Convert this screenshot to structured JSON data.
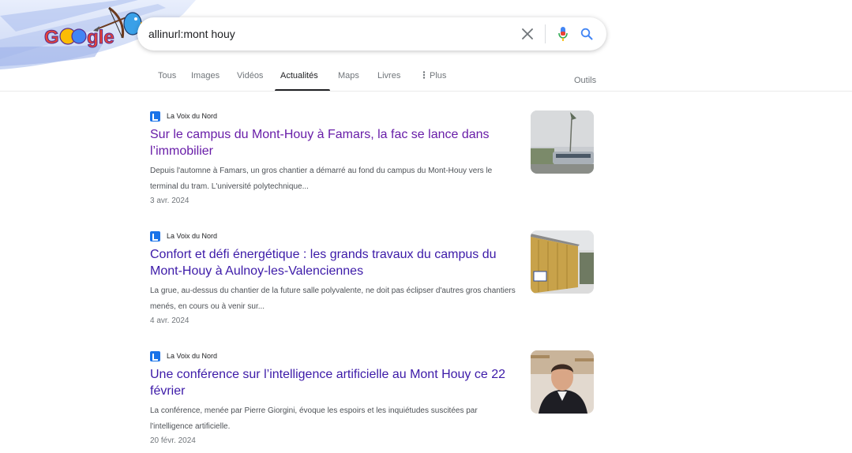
{
  "search": {
    "query": "allinurl:mont houy",
    "logo_text": "Google"
  },
  "tabs": [
    {
      "label": "Tous"
    },
    {
      "label": "Images"
    },
    {
      "label": "Vidéos"
    },
    {
      "label": "Actualités"
    },
    {
      "label": "Maps"
    },
    {
      "label": "Livres"
    },
    {
      "label": "Plus"
    }
  ],
  "active_tab": "Actualités",
  "tools_label": "Outils",
  "results": [
    {
      "source": "La Voix du Nord",
      "title": "Sur le campus du Mont-Houy à Famars, la fac se lance dans l’immobilier",
      "snippet": "Depuis l'automne à Famars, un gros chantier a démarré au fond du campus du Mont-Houy vers le terminal du tram. L'université polytechnique...",
      "date": "3 avr. 2024"
    },
    {
      "source": "La Voix du Nord",
      "title": "Confort et défi énergétique : les grands travaux du campus du Mont-Houy à Aulnoy-les-Valenciennes",
      "snippet": "La grue, au-dessus du chantier de la future salle polyvalente, ne doit pas éclipser d'autres gros chantiers menés, en cours ou à venir sur...",
      "date": "4 avr. 2024"
    },
    {
      "source": "La Voix du Nord",
      "title": "Une conférence sur l’intelligence artificielle au Mont Houy ce 22 février",
      "snippet": "La conférence, menée par Pierre Giorgini, évoque les espoirs et les inquiétudes suscitées par l'intelligence artificielle.",
      "date": "20 févr. 2024"
    }
  ],
  "icons": {
    "clear": "close-icon",
    "voice": "microphone-icon",
    "search": "search-icon",
    "more": "more-vert-icon",
    "favicon": "source-favicon-icon"
  },
  "colors": {
    "link_visited": "#681da8",
    "link": "#3c1aa8",
    "search_blue": "#4285f4",
    "mic_red": "#ea4335"
  }
}
